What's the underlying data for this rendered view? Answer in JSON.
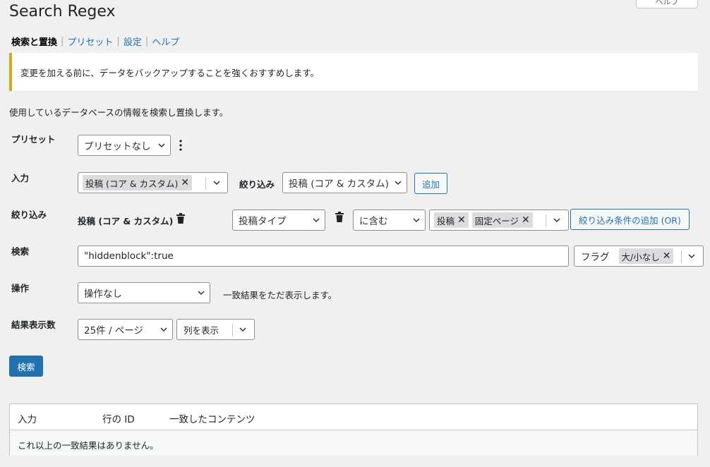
{
  "header": {
    "help_tab": "ヘルプ",
    "title": "Search Regex"
  },
  "subnav": {
    "current": "検索と置換",
    "presets": "プリセット",
    "settings": "設定",
    "help": "ヘルプ",
    "separator": "|"
  },
  "notice": {
    "text": "変更を加える前に、データをバックアップすることを強くおすすめします。",
    "accent": "#dba617"
  },
  "description": "使用しているデータベースの情報を検索し置換します。",
  "form": {
    "preset": {
      "label": "プリセット",
      "selected": "プリセットなし"
    },
    "source": {
      "label": "入力",
      "tag": "投稿 (コア & カスタム)",
      "filter_label": "絞り込み",
      "filter_select": "投稿 (コア & カスタム)",
      "add_button": "追加"
    },
    "filter": {
      "label": "絞り込み",
      "source_name": "投稿 (コア & カスタム)",
      "column": "投稿タイプ",
      "logic": "に含む",
      "tags": [
        "投稿",
        "固定ページ"
      ],
      "add_or_button": "絞り込み条件の追加 (OR)"
    },
    "search": {
      "label": "検索",
      "value": "\"hiddenblock\":true",
      "flags_label": "フラグ",
      "flag_tag": "大/小なし"
    },
    "action": {
      "label": "操作",
      "selected": "操作なし",
      "hint": "一致結果をただ表示します。"
    },
    "results": {
      "label": "結果表示数",
      "per_page": "25件 / ページ",
      "columns": "列を表示"
    },
    "submit": "検索"
  },
  "table": {
    "headers": [
      "入力",
      "行の ID",
      "一致したコンテンツ"
    ],
    "empty": "これ以上の一致結果はありません。"
  },
  "colors": {
    "primary": "#2271b1",
    "background": "#f0f0f1"
  }
}
